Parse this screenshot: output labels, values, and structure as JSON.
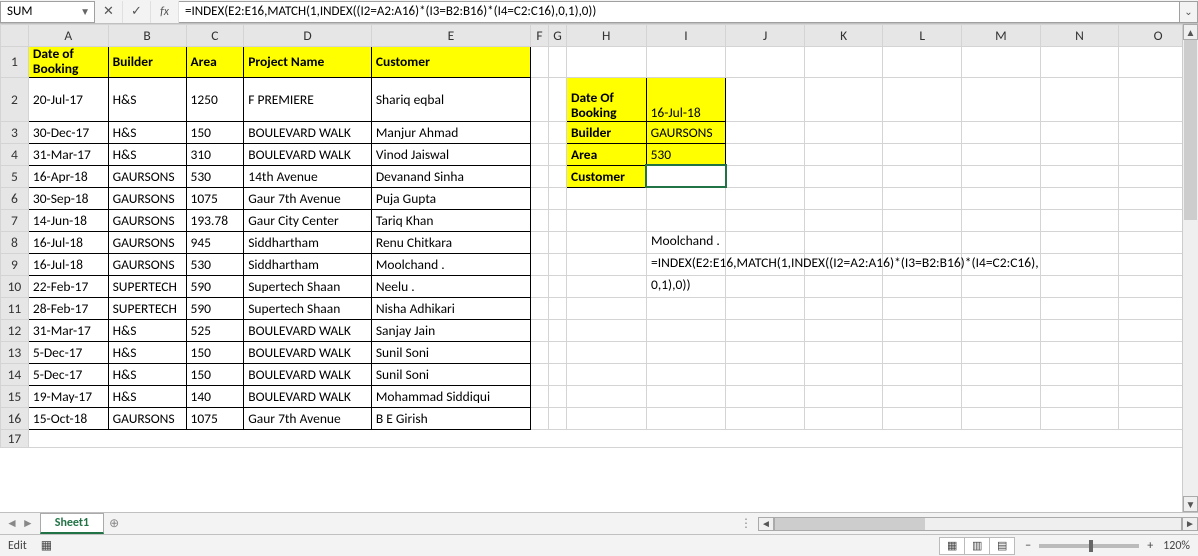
{
  "namebox": "SUM",
  "formula": "=INDEX(E2:E16,MATCH(1,INDEX((I2=A2:A16)*(I3=B2:B16)*(I4=C2:C16),0,1),0))",
  "columns": [
    "A",
    "B",
    "C",
    "D",
    "E",
    "F",
    "G",
    "H",
    "I",
    "J",
    "K",
    "L",
    "M",
    "N",
    "O"
  ],
  "headers": {
    "A": "Date of Booking",
    "B": "Builder",
    "C": "Area",
    "D": "Project Name",
    "E": "Customer"
  },
  "rows": [
    {
      "n": 2,
      "A": "20-Jul-17",
      "B": "H&S",
      "C": "1250",
      "D": "F PREMIERE",
      "E": "Shariq eqbal"
    },
    {
      "n": 3,
      "A": "30-Dec-17",
      "B": "H&S",
      "C": "150",
      "D": "BOULEVARD WALK",
      "E": "Manjur Ahmad"
    },
    {
      "n": 4,
      "A": "31-Mar-17",
      "B": "H&S",
      "C": "310",
      "D": "BOULEVARD WALK",
      "E": "Vinod Jaiswal"
    },
    {
      "n": 5,
      "A": "16-Apr-18",
      "B": "GAURSONS",
      "C": "530",
      "D": "14th Avenue",
      "E": "Devanand Sinha"
    },
    {
      "n": 6,
      "A": "30-Sep-18",
      "B": "GAURSONS",
      "C": "1075",
      "D": "Gaur 7th Avenue",
      "E": "Puja Gupta"
    },
    {
      "n": 7,
      "A": "14-Jun-18",
      "B": "GAURSONS",
      "C": "193.78",
      "D": "Gaur City Center",
      "E": "Tariq Khan"
    },
    {
      "n": 8,
      "A": "16-Jul-18",
      "B": "GAURSONS",
      "C": "945",
      "D": "Siddhartham",
      "E": "Renu Chitkara"
    },
    {
      "n": 9,
      "A": "16-Jul-18",
      "B": "GAURSONS",
      "C": "530",
      "D": "Siddhartham",
      "E": "Moolchand ."
    },
    {
      "n": 10,
      "A": "22-Feb-17",
      "B": "SUPERTECH",
      "C": "590",
      "D": "Supertech Shaan",
      "E": "Neelu ."
    },
    {
      "n": 11,
      "A": "28-Feb-17",
      "B": "SUPERTECH",
      "C": "590",
      "D": "Supertech Shaan",
      "E": "Nisha Adhikari"
    },
    {
      "n": 12,
      "A": "31-Mar-17",
      "B": "H&S",
      "C": "525",
      "D": "BOULEVARD WALK",
      "E": "Sanjay Jain"
    },
    {
      "n": 13,
      "A": "5-Dec-17",
      "B": "H&S",
      "C": "150",
      "D": "BOULEVARD WALK",
      "E": "Sunil Soni"
    },
    {
      "n": 14,
      "A": "5-Dec-17",
      "B": "H&S",
      "C": "150",
      "D": "BOULEVARD WALK",
      "E": "Sunil Soni"
    },
    {
      "n": 15,
      "A": "19-May-17",
      "B": "H&S",
      "C": "140",
      "D": "BOULEVARD WALK",
      "E": "Mohammad Siddiqui"
    },
    {
      "n": 16,
      "A": "15-Oct-18",
      "B": "GAURSONS",
      "C": "1075",
      "D": "Gaur 7th Avenue",
      "E": "B E Girish"
    }
  ],
  "lookup": {
    "h2": "Date Of Booking",
    "i2": "16-Jul-18",
    "h3": "Builder",
    "i3": "GAURSONS",
    "h4": "Area",
    "i4": "530",
    "h5": "Customer",
    "i5": "Moolchand ."
  },
  "formula_display_line1": "=INDEX(E2:E16,MATCH(1,INDEX((I2=A2:A16)*(I3=B2:B16)*(I4=C2:C16),",
  "formula_display_line2": "0,1),0))",
  "sheet_tab": "Sheet1",
  "status_mode": "Edit",
  "zoom": "120%",
  "chart_data": null
}
